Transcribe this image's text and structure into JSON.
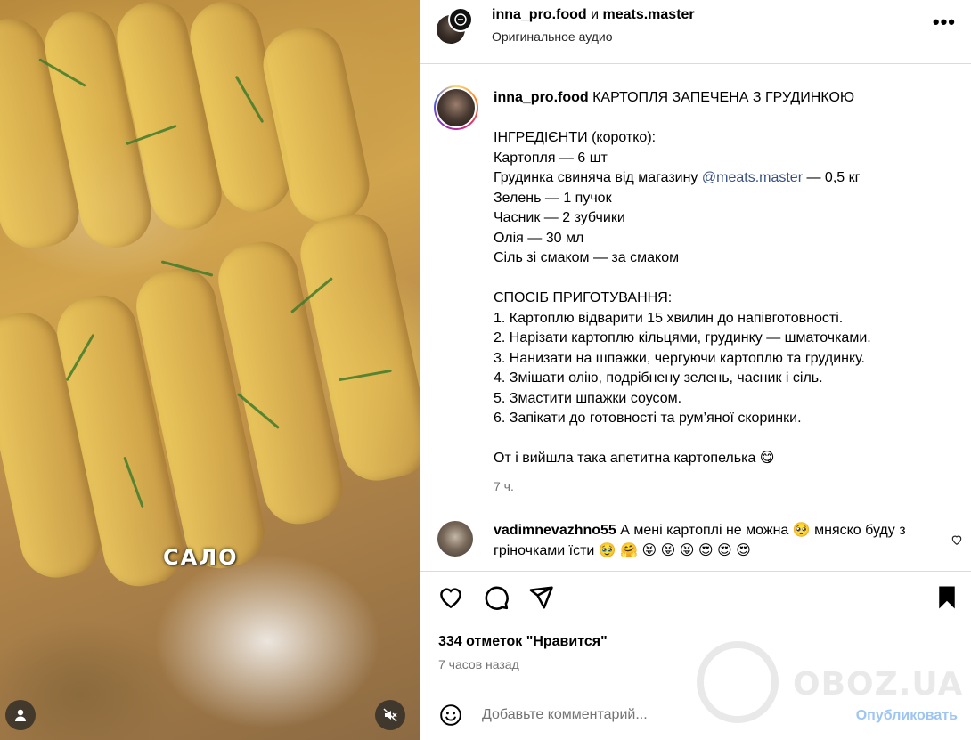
{
  "media": {
    "overlay_text": "САЛО",
    "profile_button_icon": "person-icon",
    "mute_button_icon": "speaker-muted-icon"
  },
  "header": {
    "user1": "inna_pro.food",
    "joiner": " и ",
    "user2": "meats.master",
    "audio": "Оригинальное аудио",
    "more_icon": "more-icon"
  },
  "post": {
    "username": "inna_pro.food",
    "title": " КАРТОПЛЯ ЗАПЕЧЕНА З ГРУДИНКОЮ",
    "ingredients_header": "ІНГРЕДІЄНТИ (коротко):",
    "ingredients": [
      "Картопля — 6 шт",
      "Грудинка свиняча від магазину ",
      "Зелень — 1 пучок",
      "Часник — 2 зубчики",
      "Олія — 30 мл",
      "Сіль зі смаком — за смаком"
    ],
    "mention": "@meats.master",
    "mention_tail": " — 0,5 кг",
    "method_header": "СПОСІБ ПРИГОТУВАННЯ:",
    "steps": [
      "1. Картоплю відварити 15 хвилин до напівготовності.",
      "2. Нарізати картоплю кільцями, грудинку — шматочками.",
      "3. Нанизати на шпажки, чергуючи картоплю та грудинку.",
      "4. Змішати олію, подрібнену зелень, часник і сіль.",
      "5. Змастити шпажки соусом.",
      "6. Запікати до готовності та рум’яної скоринки."
    ],
    "closing": "От і вийшла така апетитна картопелька 😋",
    "time": "7 ч."
  },
  "comment": {
    "username": "vadimnevazhno55",
    "text": " А мені картоплі не можна 🥺  мняско буду з грiночками їсти 🥹 🤗 😝 😝 😝 😍 😍 😍"
  },
  "actions": {
    "likes": "334 отметок \"Нравится\"",
    "ago": "7 часов назад"
  },
  "comment_box": {
    "placeholder": "Добавьте комментарий...",
    "publish": "Опубликовать"
  },
  "watermark": {
    "text": "OBOZ.UA"
  },
  "colors": {
    "mention": "#385185",
    "publish_disabled": "#9ec5f2",
    "secondary_text": "#737373",
    "divider": "#dbdbdb"
  }
}
